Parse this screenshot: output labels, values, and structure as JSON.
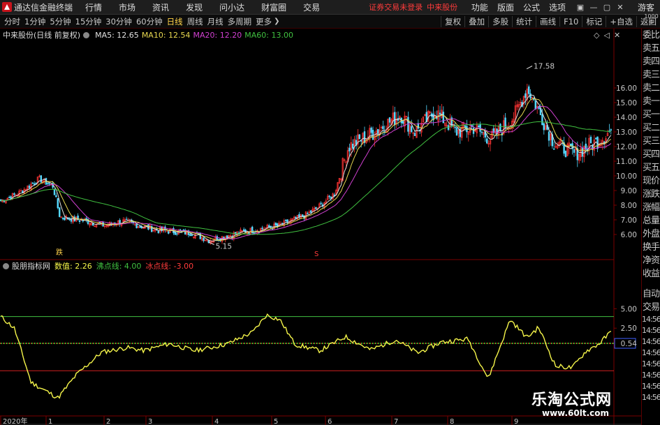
{
  "app": {
    "title": "通达信金融终端",
    "menu": [
      "行情",
      "市场",
      "资讯",
      "发现",
      "问小达",
      "财富圈",
      "交易"
    ],
    "status_warning": "证券交易未登录",
    "status_stock": "中来股份",
    "right_menu": [
      "功能",
      "版面",
      "公式",
      "选项"
    ],
    "window_buttons": [
      "▣",
      "—",
      "▢",
      "✕"
    ],
    "guest": "游客"
  },
  "toolbar": {
    "timeframes": [
      "分时",
      "1分钟",
      "5分钟",
      "15分钟",
      "30分钟",
      "60分钟",
      "日线",
      "周线",
      "月线",
      "多周期",
      "更多"
    ],
    "active_timeframe": "日线",
    "right_buttons": [
      "复权",
      "叠加",
      "多股",
      "统计",
      "画线",
      "F10",
      "标记",
      "+自选",
      "返回"
    ],
    "arrow_left": "◀",
    "arrow_right": "▶"
  },
  "main_chart": {
    "stock_title": "中来股份(日线 前复权)",
    "ma_labels": [
      {
        "text": "MA5: 12.65",
        "color": "#e0e0e0"
      },
      {
        "text": "MA10: 12.54",
        "color": "#e8d850"
      },
      {
        "text": "MA20: 12.20",
        "color": "#d040d0"
      },
      {
        "text": "MA60: 13.00",
        "color": "#40c040"
      }
    ],
    "chart_controls": [
      "◇",
      "◁",
      "✕"
    ],
    "high_label": "17.58",
    "low_label": "5.15",
    "sell_marker": "S",
    "drop_marker": "跌"
  },
  "indicator": {
    "title": "股朋指标网",
    "value_label": "数值: 2.26",
    "boil_label": "沸点线: 4.00",
    "ice_label": "冰点线: -3.00",
    "current_value": "0.54"
  },
  "sidebar": {
    "scale_top": "1000",
    "scale_sub": "0",
    "items": [
      "委比",
      "卖五",
      "卖四",
      "卖三",
      "卖二",
      "卖一",
      "买一",
      "买二",
      "买三",
      "买四",
      "买五",
      "现价",
      "涨跌",
      "涨幅",
      "总量",
      "外盘",
      "换手",
      "净资",
      "收益"
    ],
    "auto_items": [
      "自动",
      "交易"
    ],
    "times": [
      "14:56",
      "14:56",
      "14:56",
      "14:56",
      "14:56",
      "14:56",
      "14:56",
      "14:56"
    ]
  },
  "watermark": {
    "title": "乐淘公式网",
    "url": "www.60lt.com"
  },
  "colors": {
    "up": "#ff3333",
    "down": "#54d8ff",
    "ma5": "#e0e0e0",
    "ma10": "#e8d850",
    "ma20": "#d040d0",
    "ma60": "#40c040",
    "indicator_line": "#f5f54a",
    "boil_line": "#40c040",
    "ice_line": "#d02020"
  },
  "chart_data": {
    "type": "candlestick",
    "price_axis": {
      "ticks": [
        6.0,
        7.0,
        8.0,
        9.0,
        10.0,
        11.0,
        12.0,
        13.0,
        14.0,
        15.0,
        16.0
      ]
    },
    "indicator_axis": {
      "ticks": [
        5.0,
        2.5
      ]
    },
    "date_labels": [
      "2020年",
      "1",
      "2",
      "3",
      "4",
      "5",
      "6",
      "7",
      "8",
      "9"
    ],
    "ohlc_keypoints": [
      {
        "t": 0,
        "close": 8.3
      },
      {
        "t": 10,
        "close": 8.8
      },
      {
        "t": 22,
        "close": 9.8
      },
      {
        "t": 30,
        "close": 9.3
      },
      {
        "t": 34,
        "close": 7.2
      },
      {
        "t": 50,
        "close": 6.9
      },
      {
        "t": 60,
        "close": 6.6
      },
      {
        "t": 70,
        "close": 6.9
      },
      {
        "t": 90,
        "close": 6.3
      },
      {
        "t": 110,
        "close": 6.1
      },
      {
        "t": 120,
        "close": 5.6
      },
      {
        "t": 140,
        "close": 6.2
      },
      {
        "t": 160,
        "close": 6.6
      },
      {
        "t": 175,
        "close": 7.3
      },
      {
        "t": 182,
        "close": 7.8
      },
      {
        "t": 192,
        "close": 8.8
      },
      {
        "t": 200,
        "close": 12.0
      },
      {
        "t": 215,
        "close": 13.0
      },
      {
        "t": 230,
        "close": 14.2
      },
      {
        "t": 238,
        "close": 13.0
      },
      {
        "t": 250,
        "close": 14.4
      },
      {
        "t": 262,
        "close": 13.0
      },
      {
        "t": 272,
        "close": 13.3
      },
      {
        "t": 282,
        "close": 12.5
      },
      {
        "t": 295,
        "close": 14.0
      },
      {
        "t": 303,
        "close": 16.0
      },
      {
        "t": 310,
        "close": 14.3
      },
      {
        "t": 318,
        "close": 12.3
      },
      {
        "t": 330,
        "close": 11.5
      },
      {
        "t": 345,
        "close": 12.5
      },
      {
        "t": 352,
        "close": 13.2
      }
    ],
    "extremes": {
      "high": 17.58,
      "low": 5.15
    },
    "ma_last": {
      "MA5": 12.65,
      "MA10": 12.54,
      "MA20": 12.2,
      "MA60": 13.0
    },
    "indicator": {
      "name": "股朋指标网",
      "current": 2.26,
      "boil": 4.0,
      "ice": -3.0,
      "zero_ref": 0.54,
      "keypoints": [
        {
          "t": 0,
          "v": 4.0
        },
        {
          "t": 8,
          "v": 2.5
        },
        {
          "t": 18,
          "v": -4.5
        },
        {
          "t": 34,
          "v": -6.5
        },
        {
          "t": 45,
          "v": -3.5
        },
        {
          "t": 60,
          "v": -0.6
        },
        {
          "t": 75,
          "v": 0.0
        },
        {
          "t": 85,
          "v": -0.4
        },
        {
          "t": 100,
          "v": 0.5
        },
        {
          "t": 115,
          "v": -0.4
        },
        {
          "t": 125,
          "v": 0.0
        },
        {
          "t": 135,
          "v": 0.5
        },
        {
          "t": 150,
          "v": 2.0
        },
        {
          "t": 158,
          "v": 4.2
        },
        {
          "t": 166,
          "v": 3.6
        },
        {
          "t": 175,
          "v": 0.4
        },
        {
          "t": 190,
          "v": -0.4
        },
        {
          "t": 205,
          "v": 1.4
        },
        {
          "t": 220,
          "v": -0.3
        },
        {
          "t": 235,
          "v": 1.0
        },
        {
          "t": 248,
          "v": -0.7
        },
        {
          "t": 262,
          "v": 0.7
        },
        {
          "t": 278,
          "v": 1.1
        },
        {
          "t": 290,
          "v": -4.0
        },
        {
          "t": 303,
          "v": 3.6
        },
        {
          "t": 313,
          "v": 1.3
        },
        {
          "t": 320,
          "v": 2.6
        },
        {
          "t": 330,
          "v": -2.4
        },
        {
          "t": 340,
          "v": -2.6
        },
        {
          "t": 348,
          "v": -0.5
        },
        {
          "t": 356,
          "v": 0.5
        },
        {
          "t": 364,
          "v": 2.26
        }
      ]
    }
  }
}
